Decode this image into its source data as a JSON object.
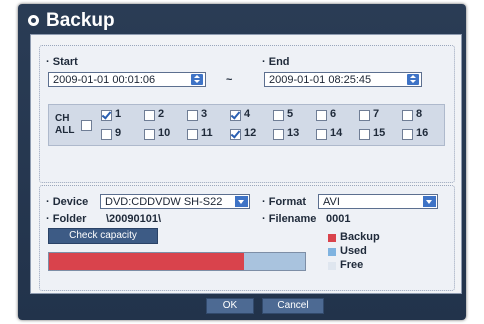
{
  "dialog": {
    "title": "Backup"
  },
  "range": {
    "start_label": "Start",
    "start_value": "2009-01-01 00:01:06",
    "separator": "~",
    "end_label": "End",
    "end_value": "2009-01-01 08:25:45"
  },
  "channels": {
    "all_label_1": "CH",
    "all_label_2": "ALL",
    "all_checked": false,
    "row1": [
      {
        "label": "1",
        "checked": true
      },
      {
        "label": "2",
        "checked": false
      },
      {
        "label": "3",
        "checked": false
      },
      {
        "label": "4",
        "checked": true
      },
      {
        "label": "5",
        "checked": false
      },
      {
        "label": "6",
        "checked": false
      },
      {
        "label": "7",
        "checked": false
      },
      {
        "label": "8",
        "checked": false
      }
    ],
    "row2": [
      {
        "label": "9",
        "checked": false
      },
      {
        "label": "10",
        "checked": false
      },
      {
        "label": "11",
        "checked": false
      },
      {
        "label": "12",
        "checked": true
      },
      {
        "label": "13",
        "checked": false
      },
      {
        "label": "14",
        "checked": false
      },
      {
        "label": "15",
        "checked": false
      },
      {
        "label": "16",
        "checked": false
      }
    ]
  },
  "device": {
    "device_label": "Device",
    "device_value": "DVD:CDDVDW SH-S22",
    "format_label": "Format",
    "format_value": "AVI",
    "folder_label": "Folder",
    "folder_value": "\\20090101\\",
    "filename_label": "Filename",
    "filename_value": "0001",
    "check_capacity_label": "Check capacity",
    "capacity_used_fraction": 0.76
  },
  "legend": {
    "backup": "Backup",
    "used": "Used",
    "free": "Free",
    "backup_color": "#d9434c",
    "used_color": "#7fb3e0",
    "free_color": "#dfe6ef"
  },
  "footer": {
    "ok_label": "OK",
    "cancel_label": "Cancel"
  }
}
